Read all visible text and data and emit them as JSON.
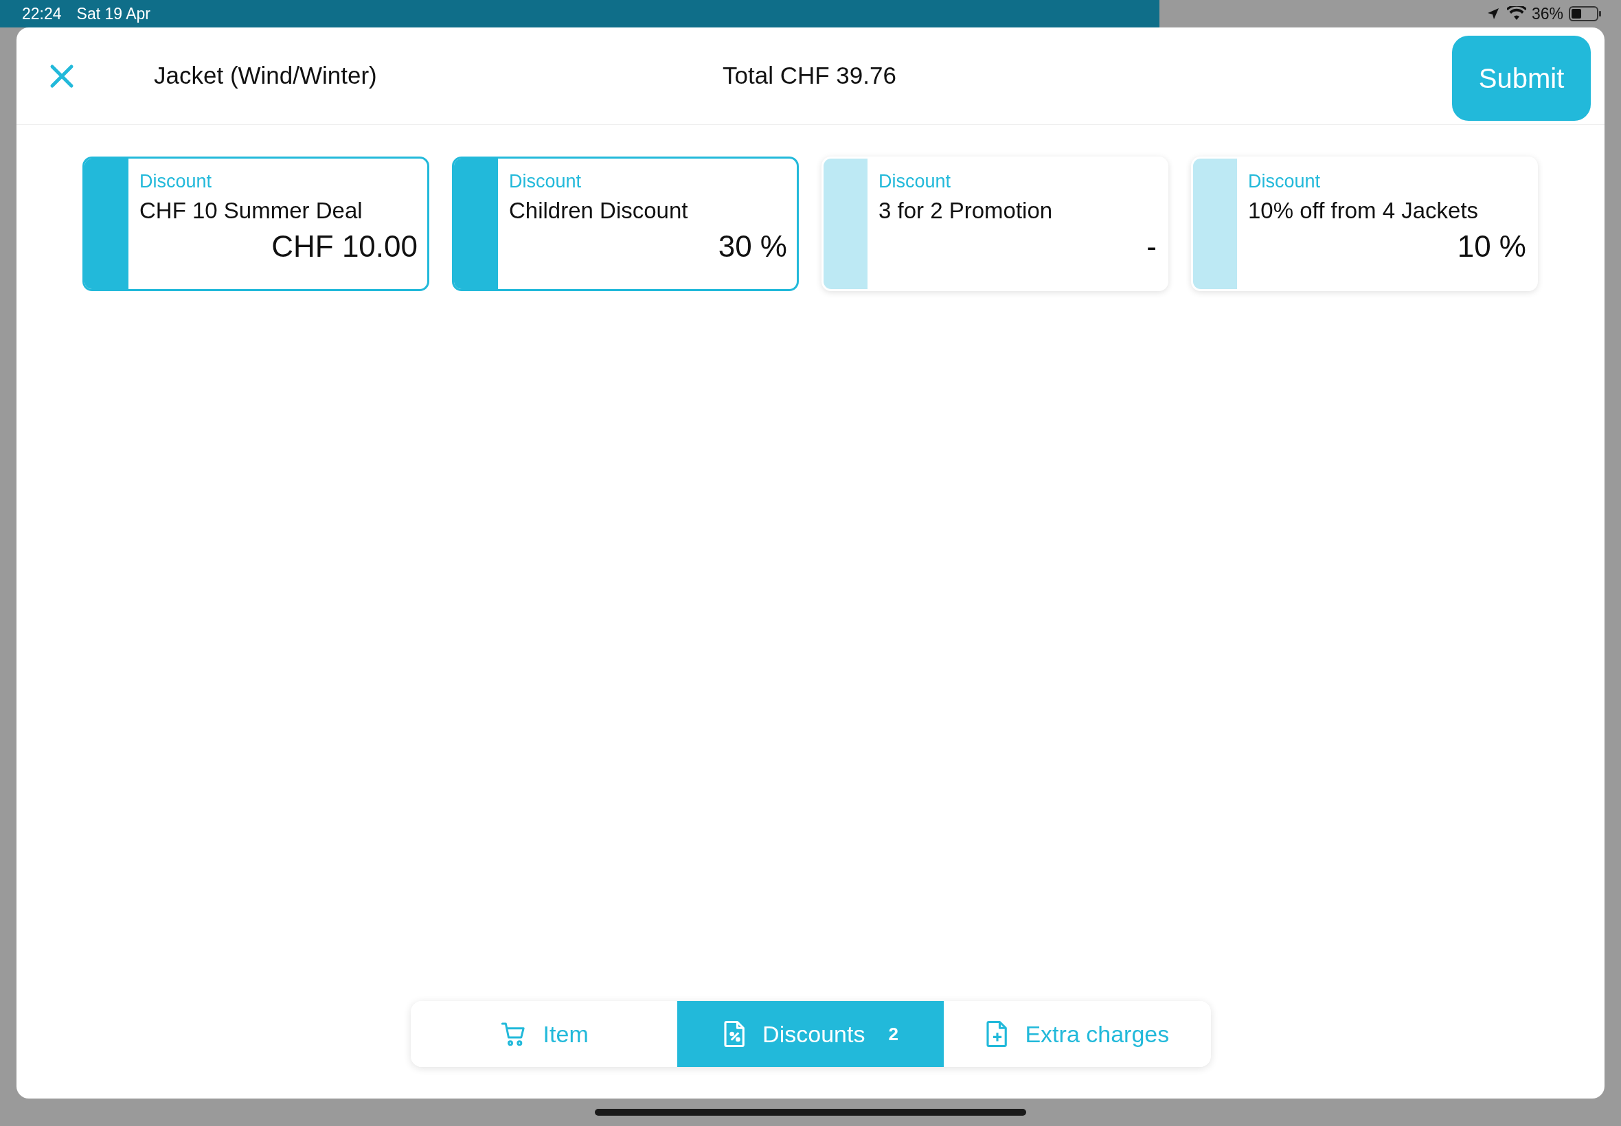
{
  "status_bar": {
    "time": "22:24",
    "date": "Sat 19 Apr",
    "battery": "36%"
  },
  "header": {
    "title": "Jacket (Wind/Winter)",
    "total": "Total CHF 39.76",
    "submit": "Submit"
  },
  "discounts": [
    {
      "label": "Discount",
      "name": "CHF 10 Summer Deal",
      "value": "CHF 10.00",
      "selected": true
    },
    {
      "label": "Discount",
      "name": "Children Discount",
      "value": "30 %",
      "selected": true
    },
    {
      "label": "Discount",
      "name": "3 for 2 Promotion",
      "value": "-",
      "selected": false
    },
    {
      "label": "Discount",
      "name": "10% off from 4 Jackets",
      "value": "10 %",
      "selected": false
    }
  ],
  "tabs": [
    {
      "kind": "cart",
      "label": "Item",
      "selected": false
    },
    {
      "kind": "discount",
      "label": "Discounts",
      "count": "2",
      "selected": true
    },
    {
      "kind": "extra",
      "label": "Extra charges",
      "selected": false
    }
  ]
}
